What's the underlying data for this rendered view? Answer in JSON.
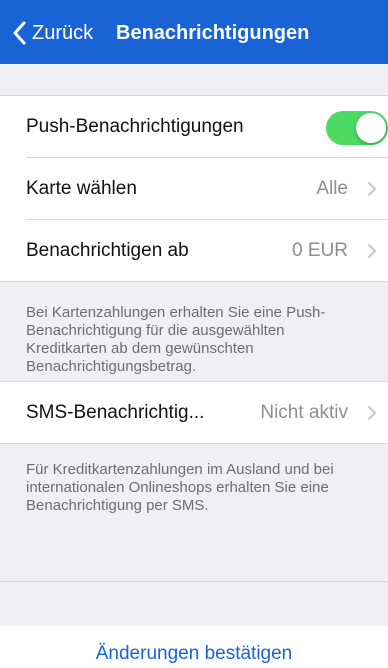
{
  "nav": {
    "back_label": "Zurück",
    "title": "Benachrichtigungen",
    "color": "#1a63d6"
  },
  "rows": {
    "push": {
      "label": "Push-Benachrichtigungen",
      "toggle_on": true,
      "toggle_color": "#4cd964"
    },
    "card": {
      "label": "Karte wählen",
      "value": "Alle"
    },
    "threshold": {
      "label": "Benachrichtigen ab",
      "value": "0 EUR"
    },
    "sms": {
      "label": "SMS-Benachrichtig...",
      "value": "Nicht aktiv"
    }
  },
  "notes": {
    "push_info": "Bei Kartenzahlungen erhalten Sie eine Push-Benachrichtigung für die ausgewählten Kreditkarten ab dem gewünschten Benachrichtigungsbetrag.",
    "sms_info": "Für Kreditkartenzahlungen im Ausland und bei internationalen Onlineshops erhalten Sie eine Benachrichtigung per SMS."
  },
  "footer": {
    "confirm_label": "Änderungen bestätigen"
  },
  "icons": {
    "back": "chevron-left-icon",
    "disclosure": "chevron-right-icon"
  }
}
